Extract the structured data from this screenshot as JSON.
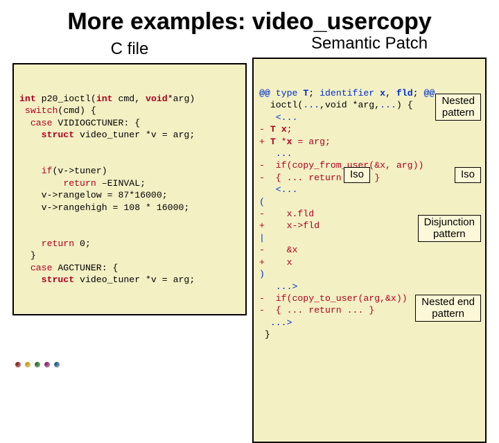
{
  "title": "More examples: video_usercopy",
  "left": {
    "heading": "C file",
    "code_html": "<span class='kw b'>int</span> p20_ioctl(<span class='kw b'>int</span> cmd, <span class='kw b'>void</span>*arg)\n <span class='kw'>switch</span>(cmd) {\n  <span class='kw'>case</span> VIDIOGCTUNER: {\n    <span class='kw b'>struct</span> video_tuner *v = arg;\n\n\n    <span class='kw'>if</span>(v-&gt;tuner)\n        <span class='kw'>return</span> –EINVAL;\n    v-&gt;rangelow = 87*16000;\n    v-&gt;rangehigh = 108 * 16000;\n\n\n    <span class='kw'>return</span> 0;\n  }\n  <span class='kw'>case</span> AGCTUNER: {\n    <span class='kw b'>struct</span> video_tuner *v = arg;"
  },
  "right": {
    "heading": "Semantic Patch",
    "code_html": "<span class='blue b'>@@</span> <span class='blue'>type</span> <span class='blue b'>T</span>; <span class='blue'>identifier</span> <span class='blue b'>x</span>, <span class='blue b'>fld</span>; <span class='blue b'>@@</span>\n  ioctl(<span class='blue'>...</span>,void *arg,<span class='blue'>...</span>) {\n   <span class='blue'>&lt;...</span>\n<span class='kw'>-</span> <span class='kw'><span class='b'>T</span> <span class='b'>x</span>;</span>\n<span class='kw'>+</span> <span class='kw'><span class='b'>T</span> *<span class='b'>x</span> = arg;</span>\n   <span class='blue'>...</span>\n<span class='kw'>-  if(copy_from_user(&amp;x, arg))</span>\n<span class='kw'>-  { ... return ...; }</span>\n   <span class='blue'>&lt;...</span>\n<span class='blue'>(</span>\n<span class='kw'>-    x.fld</span>\n<span class='kw'>+    x-&gt;fld</span>\n<span class='blue'>|</span>\n<span class='kw'>-    &amp;x</span>\n<span class='kw'>+    x</span>\n<span class='blue'>)</span>\n   <span class='blue'>...&gt;</span>\n<span class='kw'>-  if(copy_to_user(arg,&amp;x))</span>\n<span class='kw'>-  { ... return ... }</span>\n  <span class='blue'>...&gt;</span>\n }",
    "annotations": {
      "nested": "Nested\npattern",
      "iso1": "Iso",
      "iso2": "Iso",
      "disj": "Disjunction\npattern",
      "nested_end": "Nested end\npattern"
    }
  }
}
